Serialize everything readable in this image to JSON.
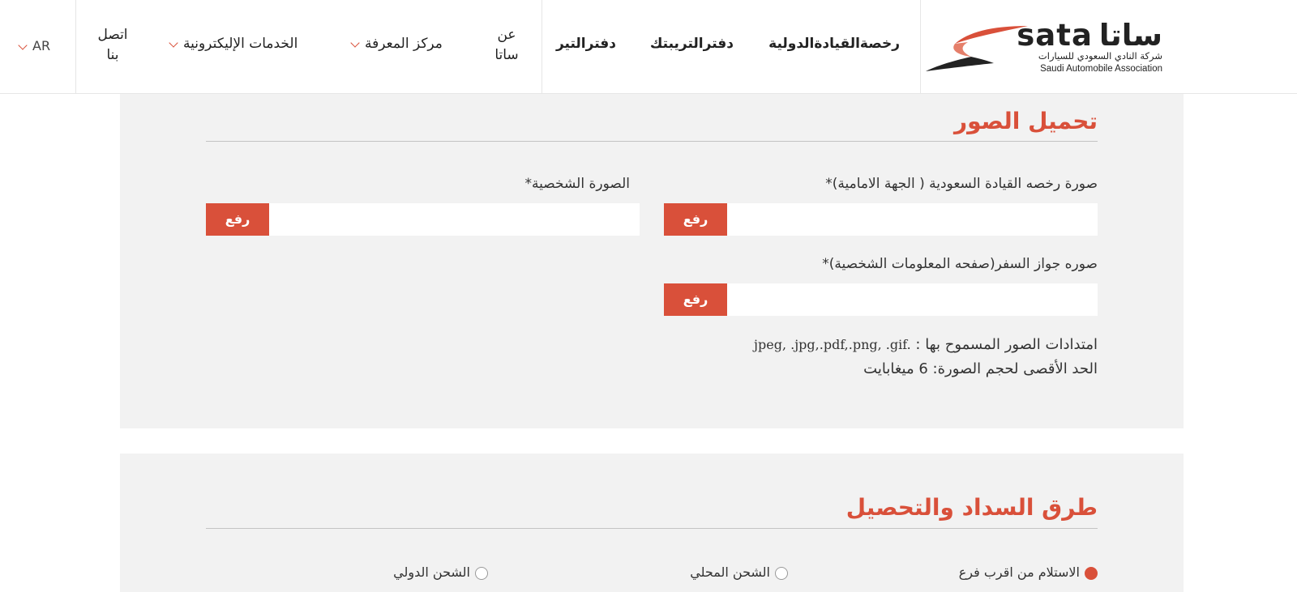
{
  "header": {
    "logo": {
      "latin": "sata",
      "arabic": "ساتا",
      "subtitle_ar": "شركة النادي السعودي للسيارات",
      "subtitle_en": "Saudi Automobile Association"
    },
    "nav": {
      "idp": "رخصةالقيادةالدولية",
      "triptyque": "دفترالتريبتك",
      "tir": "دفترالتير",
      "about_line1": "عن",
      "about_line2": "ساتا",
      "knowledge": "مركز المعرفة",
      "eservices": "الخدمات الإليكترونية",
      "contact_line1": "اتصل",
      "contact_line2": "بنا",
      "lang": "AR"
    }
  },
  "uploads": {
    "title": "تحميل الصور",
    "license_label": "صورة رخصه القيادة السعودية ( الجهة الامامية)*",
    "photo_label": "الصورة الشخصية*",
    "passport_label": "صوره جواز السفر(صفحه المعلومات الشخصية)*",
    "upload_button": "رفع",
    "extensions_label": "امتدادات الصور المسموح بها : ",
    "extensions_value": "jpeg, .jpg,.pdf,.png, .gif.",
    "max_size": "الحد الأقصى لحجم الصورة: 6 ميغابايت"
  },
  "payment": {
    "title": "طرق السداد والتحصيل",
    "options": [
      {
        "label": "الاستلام من اقرب فرع",
        "selected": true
      },
      {
        "label": "الشحن المحلي",
        "selected": false
      },
      {
        "label": "الشحن الدولي",
        "selected": false
      }
    ]
  },
  "colors": {
    "accent": "#d9503a",
    "panel": "#f2f2f2"
  }
}
